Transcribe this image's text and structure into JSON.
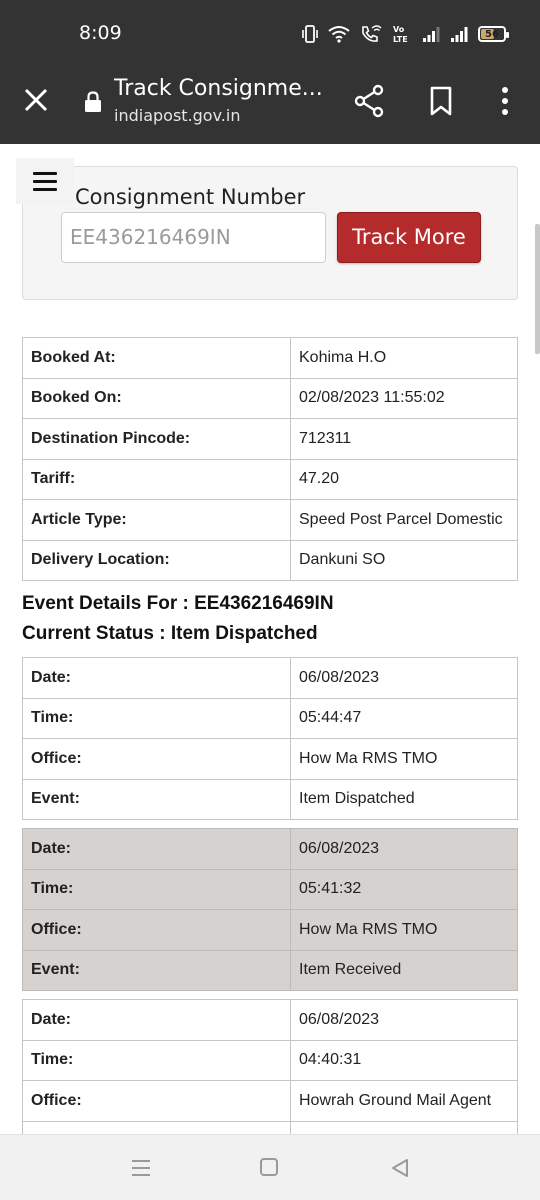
{
  "status_bar": {
    "time": "8:09",
    "battery_level": "56",
    "icons": [
      "vibrate-icon",
      "wifi-icon",
      "wifi-calling-icon",
      "volte-icon",
      "signal-icon",
      "signal-icon",
      "battery-icon"
    ]
  },
  "browser": {
    "title": "Track Consignme...",
    "url": "indiapost.gov.in"
  },
  "search": {
    "label": "Consignment Number",
    "input_value": "EE436216469IN",
    "button_label": "Track More"
  },
  "booking": [
    {
      "key": "Booked At:",
      "value": "Kohima H.O"
    },
    {
      "key": "Booked On:",
      "value": "02/08/2023 11:55:02"
    },
    {
      "key": "Destination Pincode:",
      "value": "712311"
    },
    {
      "key": "Tariff:",
      "value": "47.20"
    },
    {
      "key": "Article Type:",
      "value": "Speed Post Parcel Domestic"
    },
    {
      "key": "Delivery Location:",
      "value": "Dankuni SO"
    }
  ],
  "event_details_heading": "Event Details For : EE436216469IN",
  "current_status_heading": "Current Status : Item Dispatched",
  "events": [
    {
      "date_label": "Date:",
      "date": "06/08/2023",
      "time_label": "Time:",
      "time": "05:44:47",
      "office_label": "Office:",
      "office": "How Ma RMS TMO",
      "event_label": "Event:",
      "event": "Item Dispatched"
    },
    {
      "date_label": "Date:",
      "date": "06/08/2023",
      "time_label": "Time:",
      "time": "05:41:32",
      "office_label": "Office:",
      "office": "How Ma RMS TMO",
      "event_label": "Event:",
      "event": "Item Received"
    },
    {
      "date_label": "Date:",
      "date": "06/08/2023",
      "time_label": "Time:",
      "time": "04:40:31",
      "office_label": "Office:",
      "office": "Howrah Ground Mail Agent"
    }
  ],
  "colors": {
    "toolbar_bg": "#333333",
    "accent_button": "#b52a2a",
    "highlight_row": "#d5d2d0"
  }
}
